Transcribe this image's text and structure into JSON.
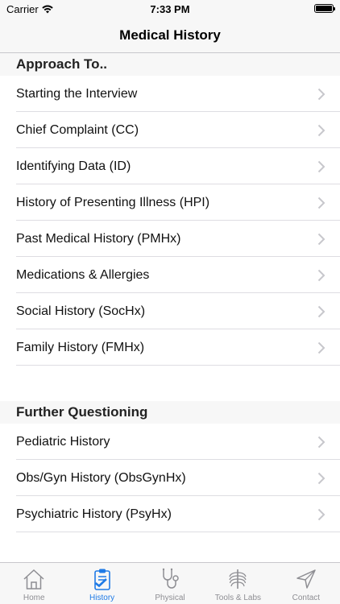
{
  "status_bar": {
    "carrier": "Carrier",
    "time": "7:33 PM"
  },
  "nav": {
    "title": "Medical History"
  },
  "sections": [
    {
      "header": "Approach To..",
      "items": [
        "Starting the Interview",
        "Chief Complaint (CC)",
        "Identifying Data (ID)",
        "History of Presenting Illness (HPI)",
        "Past Medical History (PMHx)",
        "Medications & Allergies",
        "Social History (SocHx)",
        "Family History (FMHx)"
      ]
    },
    {
      "header": "Further Questioning",
      "items": [
        "Pediatric History",
        "Obs/Gyn History (ObsGynHx)",
        "Psychiatric History (PsyHx)"
      ]
    }
  ],
  "tabs": [
    {
      "label": "Home",
      "icon": "house-icon",
      "active": false
    },
    {
      "label": "History",
      "icon": "clipboard-check-icon",
      "active": true
    },
    {
      "label": "Physical",
      "icon": "stethoscope-icon",
      "active": false
    },
    {
      "label": "Tools & Labs",
      "icon": "xray-ribcage-icon",
      "active": false
    },
    {
      "label": "Contact",
      "icon": "paper-plane-icon",
      "active": false
    }
  ],
  "colors": {
    "accent": "#1f7ae6",
    "inactive": "#8e8e93",
    "chevron": "#c7c7cc"
  }
}
